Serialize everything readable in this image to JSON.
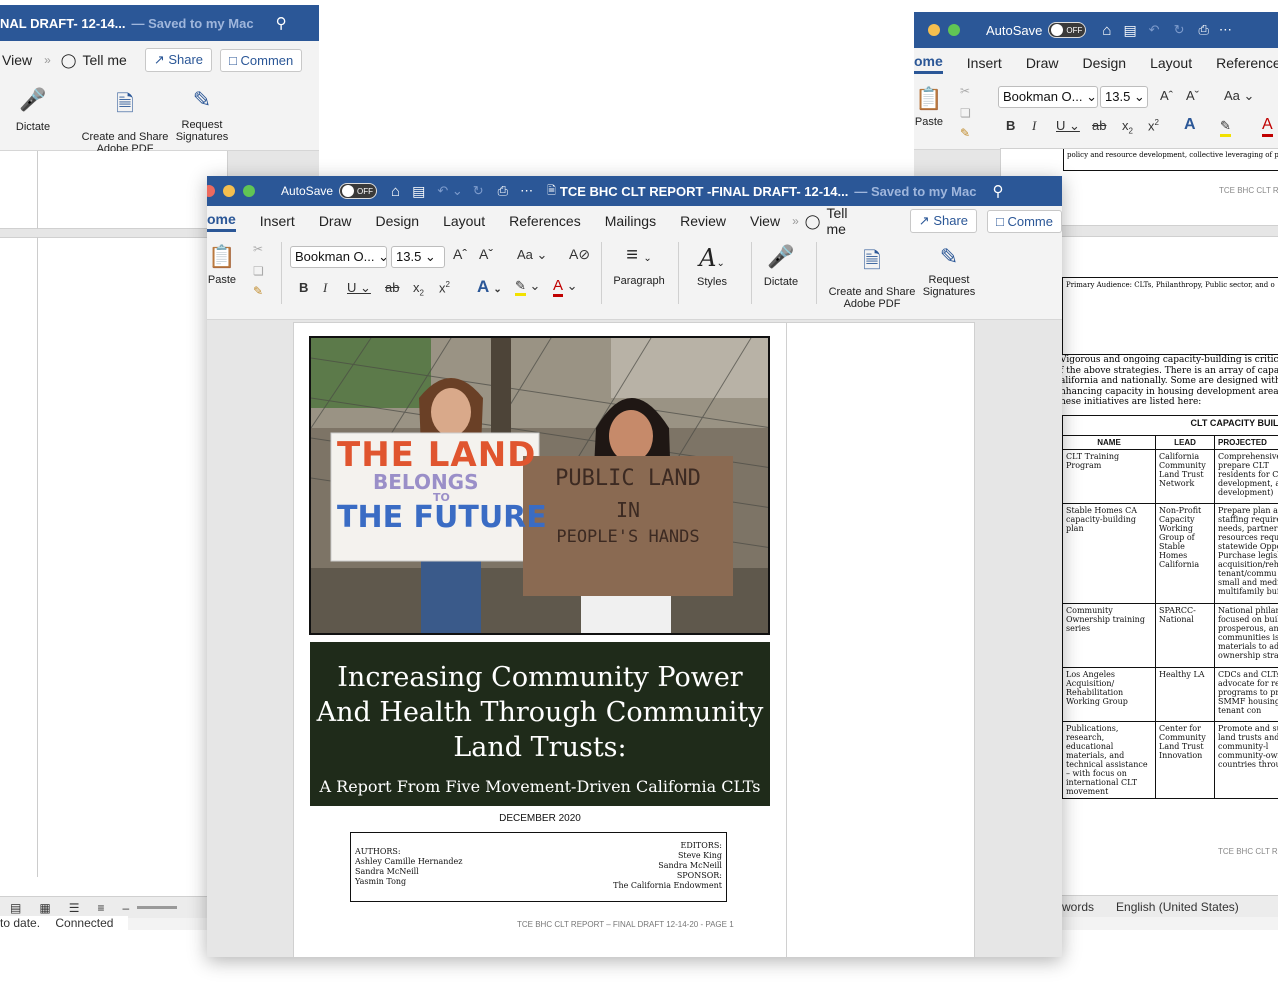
{
  "left_window": {
    "title": "NAL DRAFT- 12-14...",
    "saved": "— Saved to my Mac",
    "tabs": [
      "View",
      "Tell me"
    ],
    "share_label": "Share",
    "comments_label": "Commen",
    "dictate_label": "Dictate",
    "adobe_label_1": "Create and Share",
    "adobe_label_2": "Adobe PDF",
    "sign_label_1": "Request",
    "sign_label_2": "Signatures",
    "status_left_1": "to date.",
    "status_left_2": "Connected"
  },
  "right_window": {
    "autosave_label": "AutoSave",
    "toggle_label": "OFF",
    "tabs": [
      "ome",
      "Insert",
      "Draw",
      "Design",
      "Layout",
      "Reference"
    ],
    "font_name": "Bookman O...",
    "font_size": "13.5",
    "paste_label": "Paste",
    "top_text": "policy and resource development, collective leveraging of pu",
    "footer_1": "TCE BHC CLT R",
    "audience": "Primary Audience: CLTs, Philanthropy, Public sector, and o",
    "para_lines": [
      "Vigorous and ongoing capacity-building is critical t",
      "f the above strategies. There is an array of capacit",
      "alifornia and nationally. Some are designed with",
      "nhancing capacity in housing development areas",
      "hese initiatives are listed here:"
    ],
    "table_title": "CLT CAPACITY BUILDING",
    "table_headers": [
      "NAME",
      "LEAD",
      "PROJECTED"
    ],
    "rows": [
      {
        "name": "CLT Training Program",
        "lead": "California Community Land Trust Network",
        "proj": "Comprehensive to prepare CLT residents for Cl development, a development)"
      },
      {
        "name": "Stable Homes CA capacity-building plan",
        "lead": "Non-Profit Capacity Working Group of Stable Homes California",
        "proj": "Prepare plan ar staffing require needs, partners resources requi statewide Oppo Purchase legisla acquisition/reh tenant/commu small and medi multifamily buil"
      },
      {
        "name": "Community Ownership training series",
        "lead": "SPARCC-National",
        "proj": "National philan focused on buil prosperous, an communities is materials to ad ownership strat"
      },
      {
        "name": "Los Angeles Acquisition/ Rehabilitation Working Group",
        "lead": "Healthy LA",
        "proj": "CDCs and CLTs advocate for res programs to pre SMMF housing and tenant con"
      },
      {
        "name": "Publications, research, educational materials, and technical assistance – with focus on international CLT movement",
        "lead": "Center for Community Land Trust Innovation",
        "proj": "Promote and su land trusts and of community-l community-own countries throu"
      }
    ],
    "footer_2": "TCE BHC CLT R",
    "status_words": "words",
    "status_lang": "English (United States)"
  },
  "main_window": {
    "autosave_label": "AutoSave",
    "toggle_label": "OFF",
    "doc_title": "TCE BHC CLT REPORT -FINAL DRAFT- 12-14...",
    "saved": "— Saved to my Mac",
    "tabs": [
      "ome",
      "Insert",
      "Draw",
      "Design",
      "Layout",
      "References",
      "Mailings",
      "Review",
      "View"
    ],
    "tell_me": "Tell me",
    "share_label": "Share",
    "comments_label": "Comme",
    "paste_label": "Paste",
    "font_name": "Bookman O...",
    "font_size": "13.5",
    "paragraph_label": "Paragraph",
    "styles_label": "Styles",
    "dictate_label": "Dictate",
    "adobe_label_1": "Create and Share",
    "adobe_label_2": "Adobe PDF",
    "sign_label_1": "Request",
    "sign_label_2": "Signatures"
  },
  "cover": {
    "sign_left_1": "THE LAND",
    "sign_left_2": "BELONGS",
    "sign_left_3": "TO",
    "sign_left_4": "THE FUTURE",
    "sign_right_1": "PUBLIC LAND",
    "sign_right_2": "IN",
    "sign_right_3": "PEOPLE'S HANDS",
    "title_1": "Increasing Community Power",
    "title_2": "And Health Through Community",
    "title_3": "Land Trusts:",
    "subtitle": "A Report From Five Movement-Driven California CLTs",
    "date": "DECEMBER 2020",
    "authors_label": "AUTHORS:",
    "authors": [
      "Ashley Camille Hernandez",
      "Sandra McNeill",
      "Yasmin Tong"
    ],
    "editors_label": "EDITORS:",
    "editors": [
      "Steve King",
      "Sandra McNeill"
    ],
    "sponsor_label": "SPONSOR:",
    "sponsor": "The California Endowment",
    "footer": "TCE BHC CLT REPORT – FINAL DRAFT 12-14-20 - PAGE 1"
  },
  "colors": {
    "titlebar": "#2b5797",
    "title_box": "#1f2b1a",
    "accent": "#2b5797"
  }
}
